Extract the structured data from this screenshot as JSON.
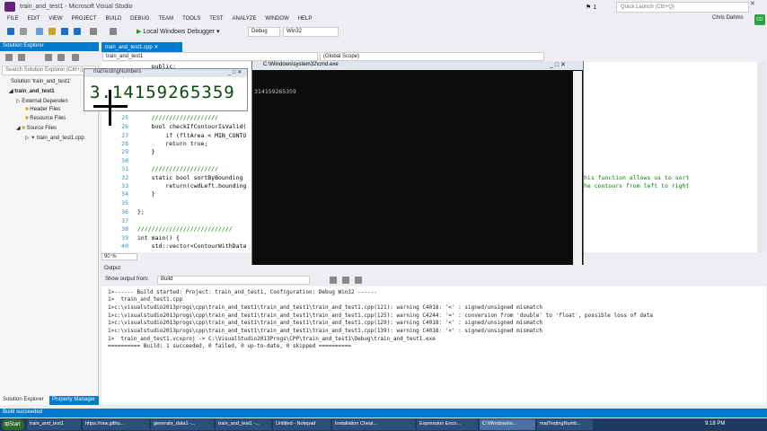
{
  "window": {
    "title": "train_and_test1 - Microsoft Visual Studio",
    "notifications": "1",
    "quick_launch_placeholder": "Quick Launch (Ctrl+Q)",
    "user": "Chris Dahms",
    "user_initials": "CD"
  },
  "menu": [
    "FILE",
    "EDIT",
    "VIEW",
    "PROJECT",
    "BUILD",
    "DEBUG",
    "TEAM",
    "TOOLS",
    "TEST",
    "ANALYZE",
    "WINDOW",
    "HELP"
  ],
  "toolbar": {
    "run_label": "Local Windows Debugger",
    "config": "Debug",
    "platform": "Win32"
  },
  "solution_explorer": {
    "title": "Solution Explorer",
    "search_placeholder": "Search Solution Explorer (Ctrl+;)",
    "items": [
      "Solution 'train_and_test1'",
      "train_and_test1",
      "External Dependen",
      "Header Files",
      "Resource Files",
      "Source Files",
      "train_and_test1.cpp"
    ],
    "tabs": [
      "Solution Explorer",
      "Property Manager"
    ]
  },
  "editor": {
    "tab": "train_and_test1.cpp",
    "nav_left": "train_and_test1",
    "nav_right": "(Global Scope)",
    "zoom": "90 %",
    "lines": [
      {
        "n": "",
        "t": "    public:"
      },
      {
        "n": "25",
        "t": "    ///////////////////"
      },
      {
        "n": "26",
        "t": "    bool checkIfContourIsValid("
      },
      {
        "n": "27",
        "t": "        if (fltArea < MIN_CONTO"
      },
      {
        "n": "28",
        "t": "        return true;"
      },
      {
        "n": "29",
        "t": "    }"
      },
      {
        "n": "30",
        "t": ""
      },
      {
        "n": "31",
        "t": "    ///////////////////"
      },
      {
        "n": "32",
        "t": "    static bool sortByBounding"
      },
      {
        "n": "33",
        "t": "        return(cwdLeft.bounding"
      },
      {
        "n": "34",
        "t": "    }"
      },
      {
        "n": "35",
        "t": ""
      },
      {
        "n": "36",
        "t": "};"
      },
      {
        "n": "37",
        "t": ""
      },
      {
        "n": "38",
        "t": "///////////////////////////"
      },
      {
        "n": "39",
        "t": "int main() {"
      },
      {
        "n": "40",
        "t": "    std::vector<ContourWithData"
      }
    ],
    "comment1": "his function allows us to sort",
    "comment2": "he contours from left to right"
  },
  "cmd": {
    "title": "C:\\Windows\\system32\\cmd.exe",
    "output": "314159265359"
  },
  "opencv_window": {
    "title": "matTestingNumbers",
    "number": "3.14159265359"
  },
  "output": {
    "title": "Output",
    "show_from_label": "Show output from:",
    "source": "Build",
    "lines": [
      "1>------ Build started: Project: train_and_test1, Configuration: Debug Win32 ------",
      "1>  train_and_test1.cpp",
      "1>c:\\visualstudio2013progs\\cpp\\train_and_test1\\train_and_test1\\train_and_test1.cpp(121): warning C4018: '<' : signed/unsigned mismatch",
      "1>c:\\visualstudio2013progs\\cpp\\train_and_test1\\train_and_test1\\train_and_test1.cpp(125): warning C4244: '=' : conversion from 'double' to 'float', possible loss of data",
      "1>c:\\visualstudio2013progs\\cpp\\train_and_test1\\train_and_test1\\train_and_test1.cpp(129): warning C4018: '<' : signed/unsigned mismatch",
      "1>c:\\visualstudio2013progs\\cpp\\train_and_test1\\train_and_test1\\train_and_test1.cpp(139): warning C4018: '<' : signed/unsigned mismatch",
      "1>  train_and_test1.vcxproj -> C:\\VisualStudio2013Progs\\CPP\\train_and_test1\\Debug\\train_and_test1.exe",
      "========== Build: 1 succeeded, 0 failed, 0 up-to-date, 0 skipped =========="
    ]
  },
  "status": "Build succeeded",
  "taskbar": {
    "start": "Start",
    "clock": "9:18 PM",
    "items": [
      "train_and_test1",
      "https://raw.githu...",
      "generate_data1 -...",
      "train_and_test1 -...",
      "Untitled - Notepad",
      "Installation Cheat...",
      "Expression Enco...",
      "C:\\Windows\\s...",
      "matTestingNumb..."
    ]
  },
  "colors": {
    "accent": "#007acc",
    "vs_purple": "#68217a"
  }
}
